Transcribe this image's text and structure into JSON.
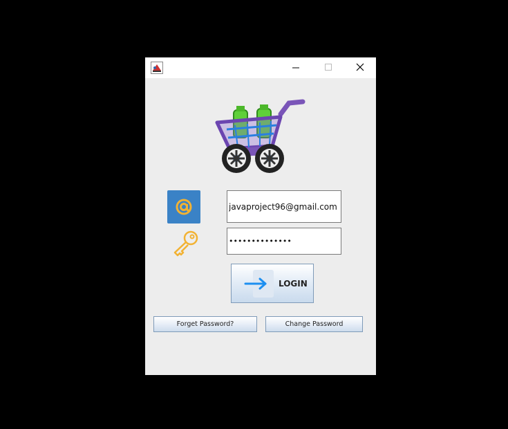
{
  "window": {
    "controls": {
      "minimize": "minimize-icon",
      "maximize": "maximize-icon",
      "close": "close-icon"
    }
  },
  "form": {
    "email_value": "javaproject96@gmail.com",
    "password_value": "••••••••••••••",
    "login_label": "LOGIN",
    "forget_label": "Forget Password?",
    "change_label": "Change Password"
  },
  "colors": {
    "email_icon_bg": "#3a82c6",
    "email_icon_fg": "#f2b233",
    "key_icon": "#f2b233",
    "arrow": "#1d8ff0"
  }
}
